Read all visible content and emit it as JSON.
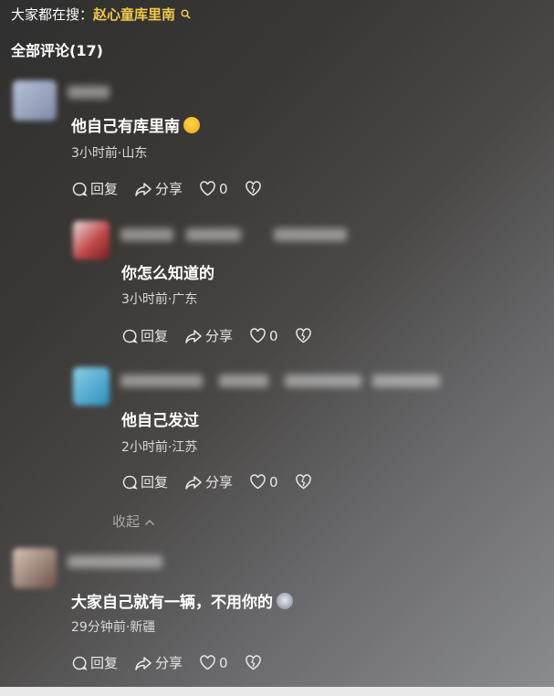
{
  "search": {
    "prefix": "大家都在搜：",
    "keyword": "赵心童库里南"
  },
  "comments_header": {
    "label": "全部评论(17)"
  },
  "comments": [
    {
      "text": "他自己有库里南",
      "meta": "3小时前·山东",
      "reply": "回复",
      "share": "分享",
      "likes": "0"
    },
    {
      "text": "你怎么知道的",
      "meta": "3小时前·广东",
      "reply": "回复",
      "share": "分享",
      "likes": "0"
    },
    {
      "text": "他自己发过",
      "meta": "2小时前·江苏",
      "reply": "回复",
      "share": "分享",
      "likes": "0"
    },
    {
      "text": "大家自己就有一辆，不用你的",
      "meta": "29分钟前·新疆",
      "reply": "回复",
      "share": "分享",
      "likes": "0"
    }
  ],
  "collapse_label": "收起",
  "icons": [
    "search-icon",
    "laugh-emoji",
    "cat-emoji",
    "reply-icon",
    "share-icon",
    "heart-icon",
    "broken-heart-icon",
    "chevron-up-icon"
  ],
  "colors": {
    "keyword": "#f0c84a",
    "meta": "#d8d8d8"
  }
}
